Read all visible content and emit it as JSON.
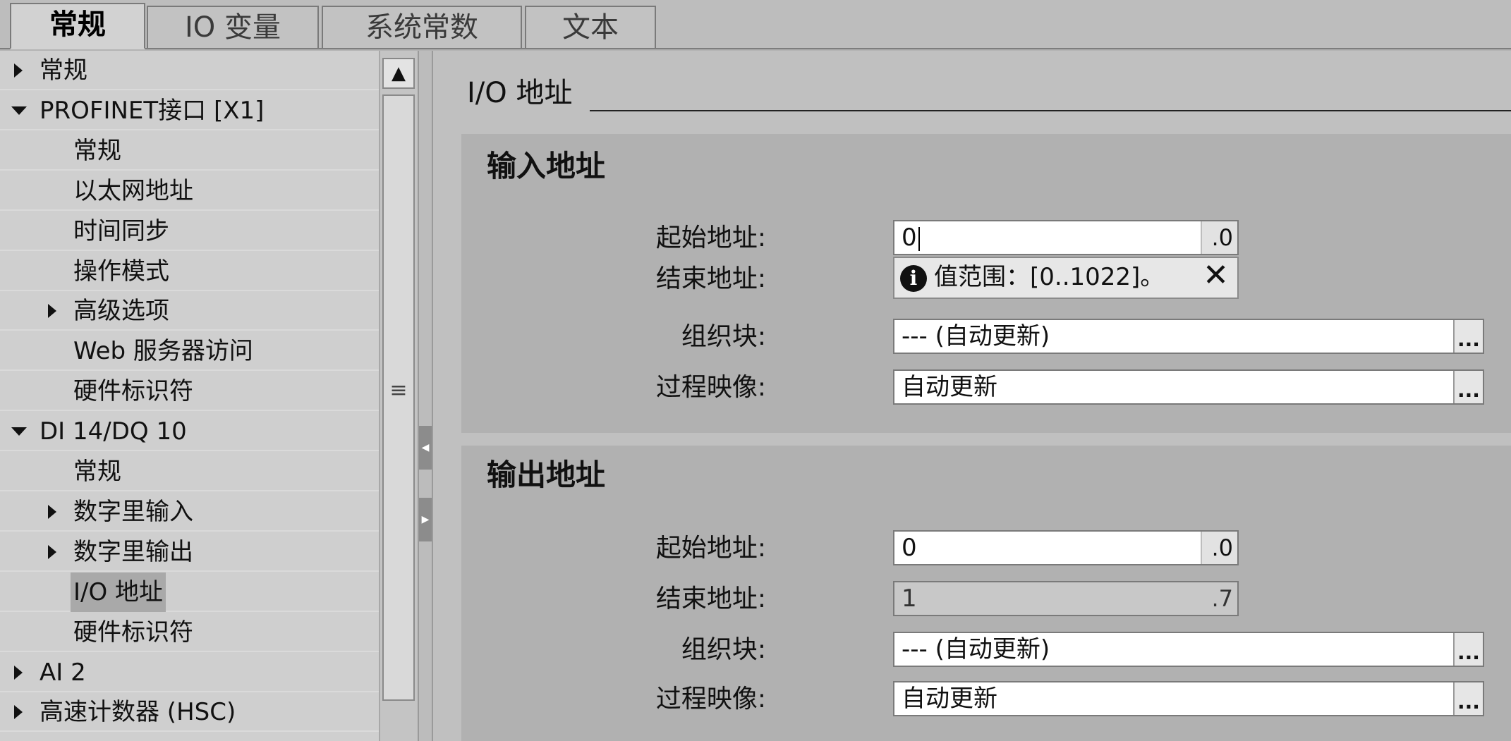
{
  "tabs": [
    {
      "label": "常规",
      "active": true
    },
    {
      "label": "IO 变量",
      "active": false
    },
    {
      "label": "系统常数",
      "active": false
    },
    {
      "label": "文本",
      "active": false
    }
  ],
  "tree": {
    "items": [
      {
        "label": "常规",
        "expand": "collapsed",
        "level": 0
      },
      {
        "label": "PROFINET接口 [X1]",
        "expand": "expanded",
        "level": 0
      },
      {
        "label": "常规",
        "expand": "none",
        "level": 1
      },
      {
        "label": "以太网地址",
        "expand": "none",
        "level": 1
      },
      {
        "label": "时间同步",
        "expand": "none",
        "level": 1
      },
      {
        "label": "操作模式",
        "expand": "none",
        "level": 1
      },
      {
        "label": "高级选项",
        "expand": "collapsed",
        "level": 1
      },
      {
        "label": "Web 服务器访问",
        "expand": "none",
        "level": 1
      },
      {
        "label": "硬件标识符",
        "expand": "none",
        "level": 1
      },
      {
        "label": "DI 14/DQ 10",
        "expand": "expanded",
        "level": 0
      },
      {
        "label": "常规",
        "expand": "none",
        "level": 1
      },
      {
        "label": "数字里输入",
        "expand": "collapsed",
        "level": 1
      },
      {
        "label": "数字里输出",
        "expand": "collapsed",
        "level": 1
      },
      {
        "label": "I/O 地址",
        "expand": "none",
        "level": 1,
        "selected": true
      },
      {
        "label": "硬件标识符",
        "expand": "none",
        "level": 1
      },
      {
        "label": "AI 2",
        "expand": "collapsed",
        "level": 0
      },
      {
        "label": "高速计数器 (HSC)",
        "expand": "collapsed",
        "level": 0
      }
    ],
    "scroll_up": "▲",
    "scroll_grip": "≡"
  },
  "splitter": {
    "collapse_left": "◀",
    "collapse_right": "▶"
  },
  "main": {
    "section_title": "I/O 地址",
    "input_group": {
      "title": "输入地址",
      "start_label": "起始地址:",
      "start_value": "0",
      "start_suffix": ".0",
      "end_label": "结束地址:",
      "tooltip_icon": "i",
      "tooltip_text": "值范围：[0..1022]。",
      "tooltip_close": "✕",
      "ob_label": "组织块:",
      "ob_value": "--- (自动更新)",
      "pi_label": "过程映像:",
      "pi_value": "自动更新",
      "ellipsis": "..."
    },
    "output_group": {
      "title": "输出地址",
      "start_label": "起始地址:",
      "start_value": "0",
      "start_suffix": ".0",
      "end_label": "结束地址:",
      "end_value": "1",
      "end_suffix": ".7",
      "ob_label": "组织块:",
      "ob_value": "--- (自动更新)",
      "pi_label": "过程映像:",
      "pi_value": "自动更新",
      "ellipsis": "..."
    }
  }
}
